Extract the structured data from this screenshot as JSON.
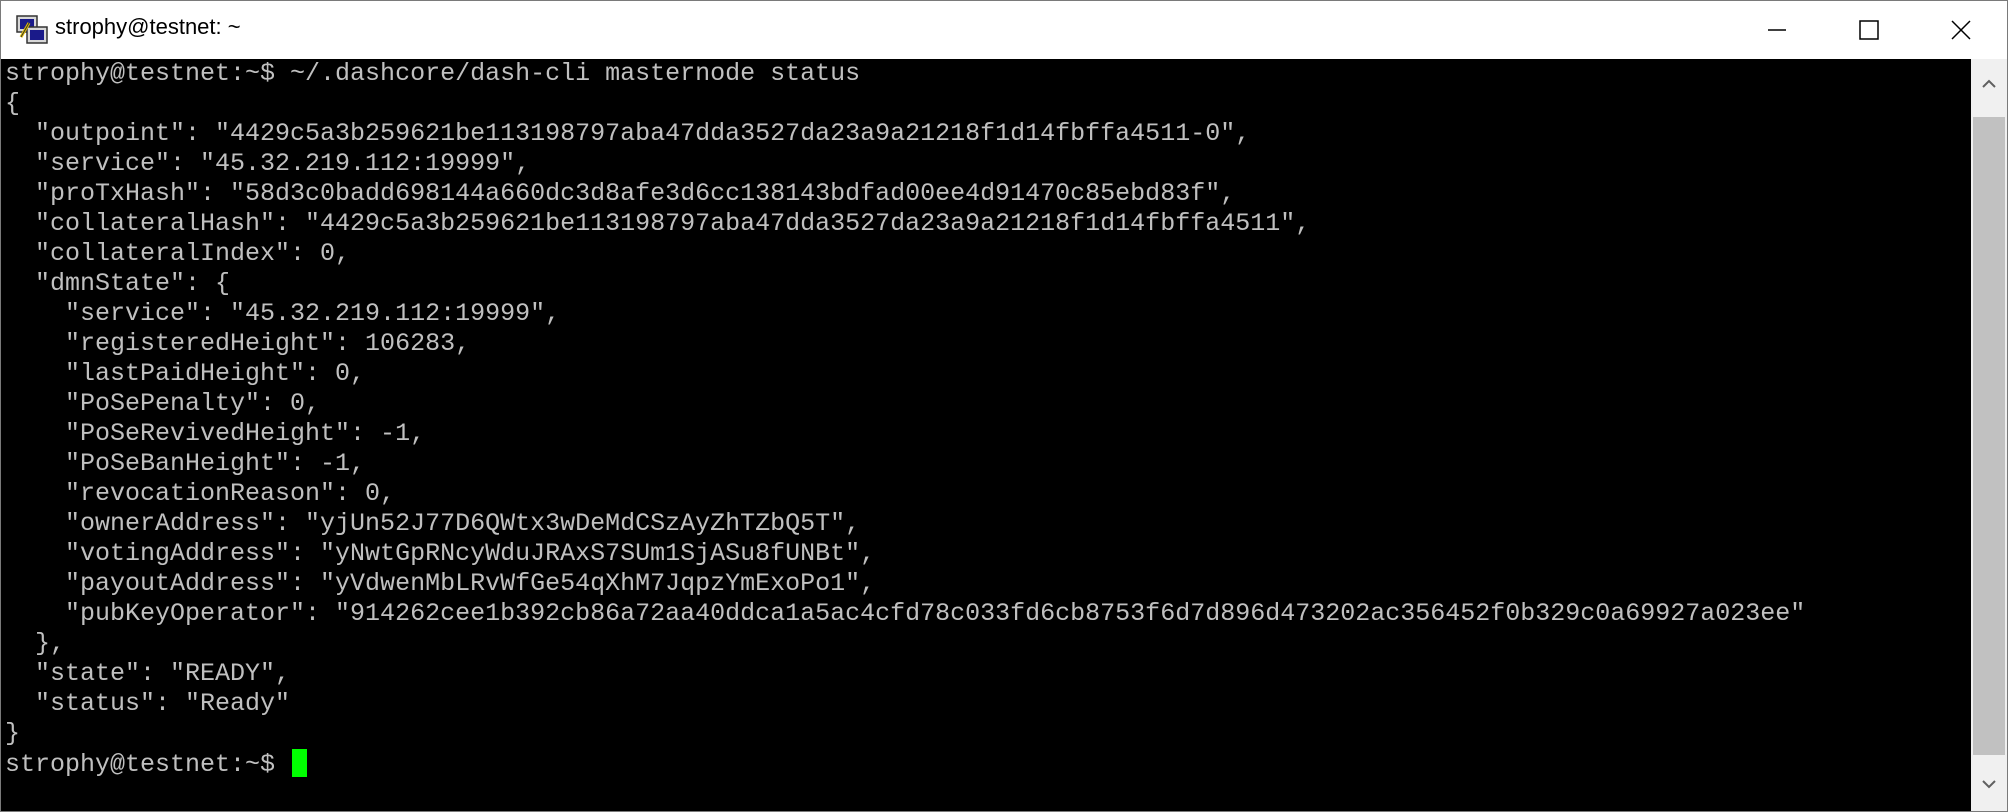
{
  "window": {
    "title": "strophy@testnet: ~",
    "minimize_icon": "minimize-icon",
    "maximize_icon": "maximize-icon",
    "close_icon": "close-icon",
    "app_icon": "putty-terminal-icon"
  },
  "colors": {
    "terminal_bg": "#000000",
    "terminal_fg": "#c0c0c0",
    "cursor": "#00ff00",
    "titlebar_bg": "#ffffff",
    "scrollbar_thumb": "#c1c1c1"
  },
  "terminal": {
    "prompt": "strophy@testnet:~$ ",
    "command": "~/.dashcore/dash-cli masternode status",
    "output_lines": [
      "{",
      "  \"outpoint\": \"4429c5a3b259621be113198797aba47dda3527da23a9a21218f1d14fbffa4511-0\",",
      "  \"service\": \"45.32.219.112:19999\",",
      "  \"proTxHash\": \"58d3c0badd698144a660dc3d8afe3d6cc138143bdfad00ee4d91470c85ebd83f\",",
      "  \"collateralHash\": \"4429c5a3b259621be113198797aba47dda3527da23a9a21218f1d14fbffa4511\",",
      "  \"collateralIndex\": 0,",
      "  \"dmnState\": {",
      "    \"service\": \"45.32.219.112:19999\",",
      "    \"registeredHeight\": 106283,",
      "    \"lastPaidHeight\": 0,",
      "    \"PoSePenalty\": 0,",
      "    \"PoSeRevivedHeight\": -1,",
      "    \"PoSeBanHeight\": -1,",
      "    \"revocationReason\": 0,",
      "    \"ownerAddress\": \"yjUn52J77D6QWtx3wDeMdCSzAyZhTZbQ5T\",",
      "    \"votingAddress\": \"yNwtGpRNcyWduJRAxS7SUm1SjASu8fUNBt\",",
      "    \"payoutAddress\": \"yVdwenMbLRvWfGe54qXhM7JqpzYmExoPo1\",",
      "    \"pubKeyOperator\": \"914262cee1b392cb86a72aa40ddca1a5ac4cfd78c033fd6cb8753f6d7d896d473202ac356452f0b329c0a69927a023ee\"",
      "  },",
      "  \"state\": \"READY\",",
      "  \"status\": \"Ready\"",
      "}"
    ],
    "final_prompt": "strophy@testnet:~$ "
  }
}
